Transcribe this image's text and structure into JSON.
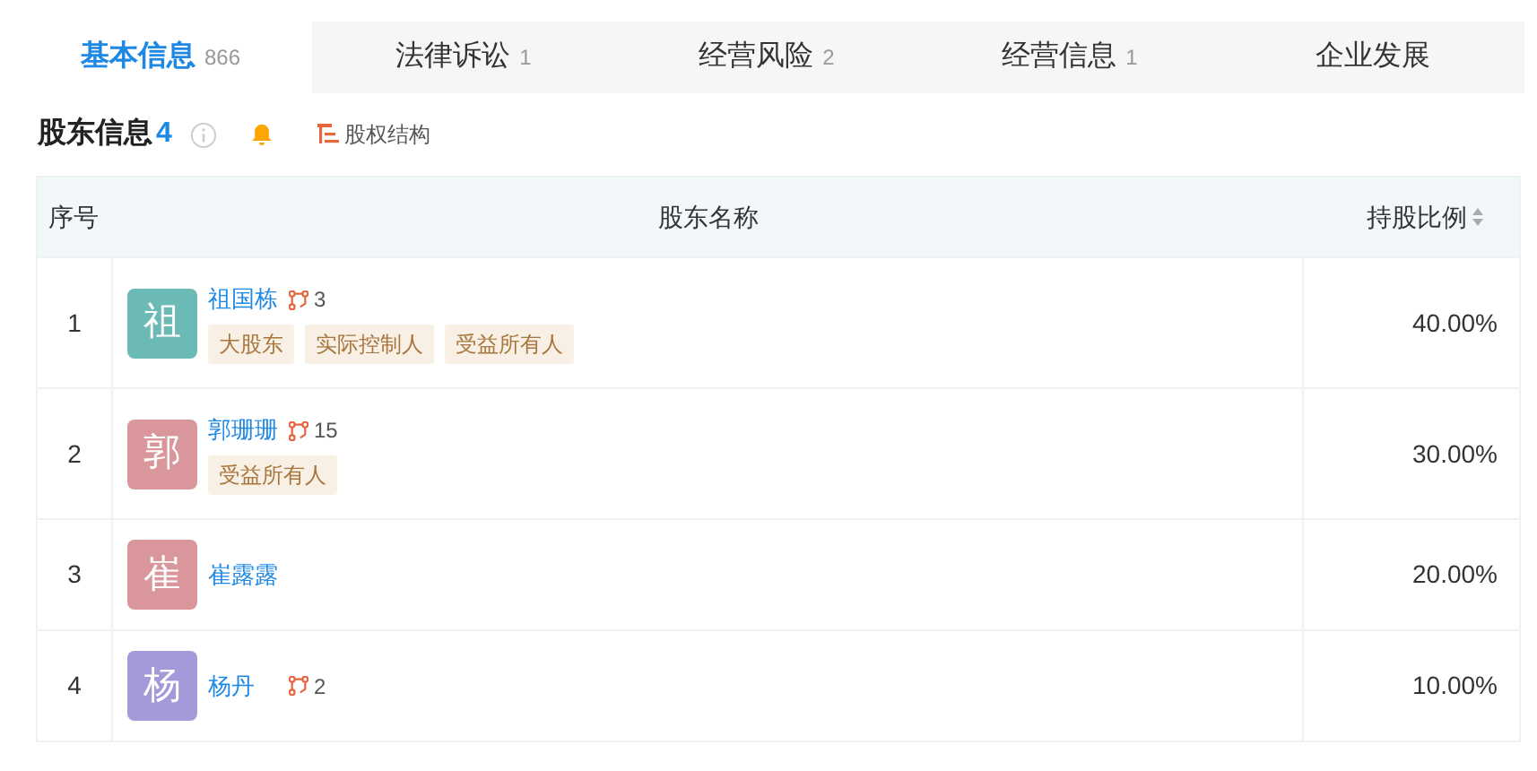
{
  "tabs": [
    {
      "label": "基本信息",
      "count": "866",
      "selected": true
    },
    {
      "label": "法律诉讼",
      "count": "1",
      "selected": false
    },
    {
      "label": "经营风险",
      "count": "2",
      "selected": false
    },
    {
      "label": "经营信息",
      "count": "1",
      "selected": false
    },
    {
      "label": "企业发展",
      "selected": false
    }
  ],
  "section": {
    "title": "股东信息",
    "count": "4",
    "link": "股权结构"
  },
  "table": {
    "columns": [
      "序号",
      "股东名称",
      "持股比例"
    ],
    "rows": [
      {
        "index": "1",
        "avatar": "祖",
        "color": "#6cbab5",
        "name": "祖国栋",
        "relations": "3",
        "tags": [
          "大股东",
          "实际控制人",
          "受益所有人"
        ],
        "ratio": "40.00%"
      },
      {
        "index": "2",
        "avatar": "郭",
        "color": "#d9969b",
        "name": "郭珊珊",
        "relations": "15",
        "tags": [
          "受益所有人"
        ],
        "ratio": "30.00%"
      },
      {
        "index": "3",
        "avatar": "崔",
        "color": "#d9969b",
        "name": "崔露露",
        "ratio": "20.00%"
      },
      {
        "index": "4",
        "avatar": "杨",
        "color": "#a59ad9",
        "name": "杨丹",
        "relations": "2",
        "ratio": "10.00%"
      }
    ]
  }
}
